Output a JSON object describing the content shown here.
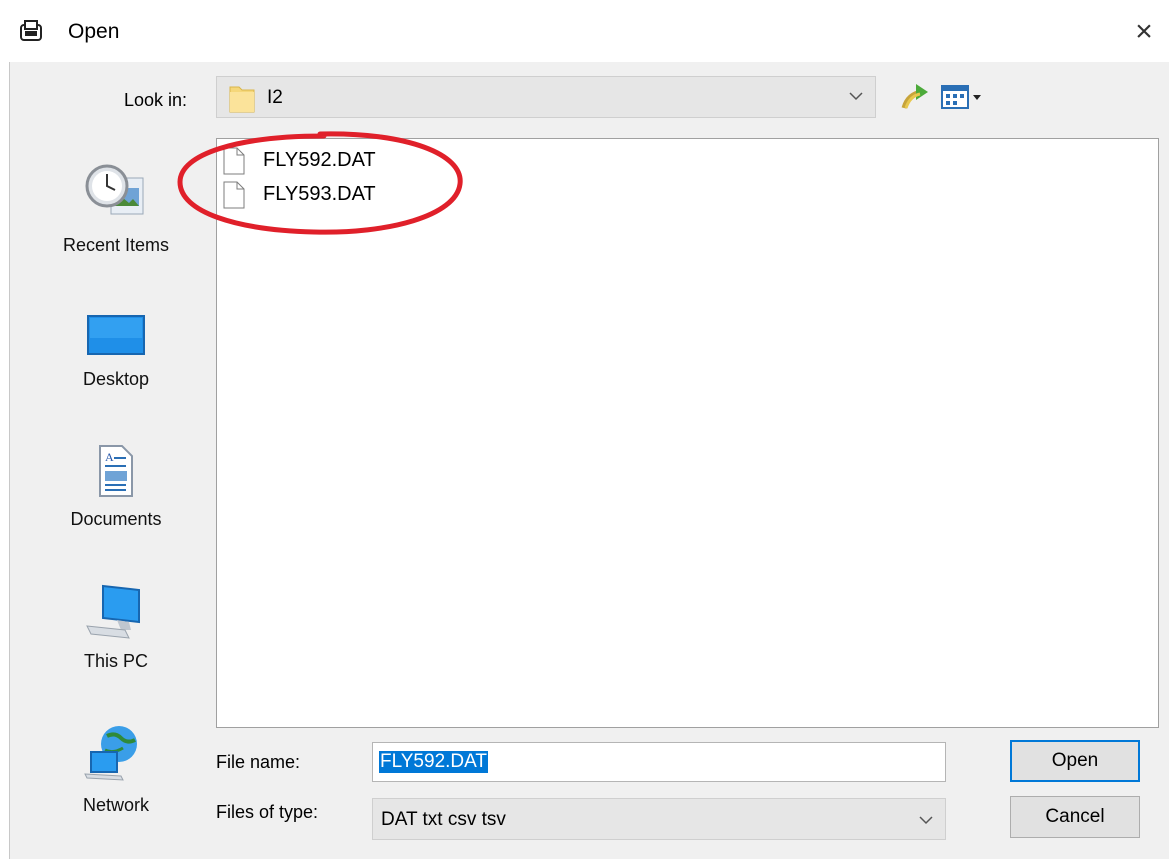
{
  "window": {
    "title": "Open",
    "close_glyph": "×"
  },
  "look_in": {
    "label": "Look in:",
    "value": "I2"
  },
  "places": [
    {
      "label": "Recent Items",
      "icon": "recent-items-icon"
    },
    {
      "label": "Desktop",
      "icon": "desktop-icon"
    },
    {
      "label": "Documents",
      "icon": "documents-icon"
    },
    {
      "label": "This PC",
      "icon": "this-pc-icon"
    },
    {
      "label": "Network",
      "icon": "network-icon"
    }
  ],
  "files": [
    {
      "name": "FLY592.DAT",
      "icon": "file-icon"
    },
    {
      "name": "FLY593.DAT",
      "icon": "file-icon"
    }
  ],
  "file_name": {
    "label": "File name:",
    "value": "FLY592.DAT"
  },
  "file_type": {
    "label": "Files of type:",
    "value": "DAT txt csv tsv"
  },
  "buttons": {
    "open": "Open",
    "cancel": "Cancel"
  },
  "colors": {
    "accent": "#0078d7",
    "annotation": "#e0202a",
    "panel": "#f0f0f0"
  }
}
